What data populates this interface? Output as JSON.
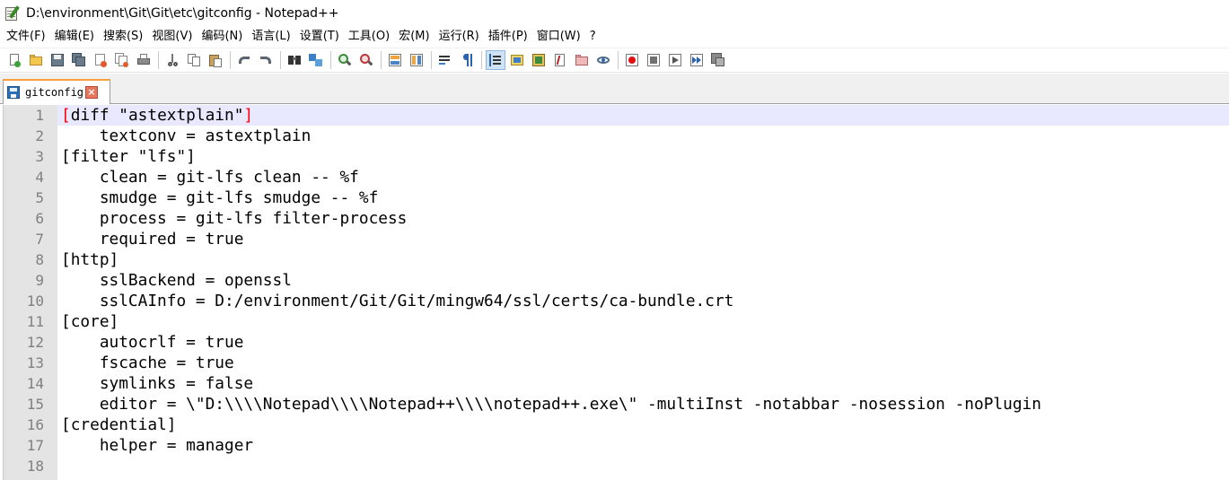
{
  "window": {
    "title": "D:\\environment\\Git\\Git\\etc\\gitconfig - Notepad++"
  },
  "menu": [
    "文件(F)",
    "编辑(E)",
    "搜索(S)",
    "视图(V)",
    "编码(N)",
    "语言(L)",
    "设置(T)",
    "工具(O)",
    "宏(M)",
    "运行(R)",
    "插件(P)",
    "窗口(W)",
    "?"
  ],
  "toolbar": {
    "icons": [
      "new-file-icon",
      "open-file-icon",
      "save-icon",
      "save-all-icon",
      "close-icon",
      "close-all-icon",
      "print-icon",
      "cut-icon",
      "copy-icon",
      "paste-icon",
      "undo-icon",
      "redo-icon",
      "find-icon",
      "replace-icon",
      "zoom-in-icon",
      "zoom-out-icon",
      "sync-vertical-scroll-icon",
      "sync-horizontal-scroll-icon",
      "word-wrap-icon",
      "show-all-characters-icon",
      "indent-guide-icon",
      "user-defined-language-icon",
      "document-map-icon",
      "function-list-icon",
      "folder-as-workspace-icon",
      "monitoring-icon",
      "record-macro-icon",
      "stop-recording-icon",
      "playback-macro-icon",
      "run-macro-multiple-icon",
      "save-macro-icon"
    ]
  },
  "tab": {
    "label": "gitconfig",
    "close_icon": "close-tab-icon",
    "status": "saved"
  },
  "editor": {
    "current_line": 1,
    "lines": [
      "[diff \"astextplain\"]",
      "    textconv = astextplain",
      "[filter \"lfs\"]",
      "    clean = git-lfs clean -- %f",
      "    smudge = git-lfs smudge -- %f",
      "    process = git-lfs filter-process",
      "    required = true",
      "[http]",
      "    sslBackend = openssl",
      "    sslCAInfo = D:/environment/Git/Git/mingw64/ssl/certs/ca-bundle.crt",
      "[core]",
      "    autocrlf = true",
      "    fscache = true",
      "    symlinks = false",
      "    editor = \\\"D:\\\\\\\\Notepad\\\\\\\\Notepad++\\\\\\\\notepad++.exe\\\" -multiInst -notabbar -nosession -noPlugin",
      "[credential]",
      "    helper = manager",
      ""
    ],
    "line_numbers": [
      "1",
      "2",
      "3",
      "4",
      "5",
      "6",
      "7",
      "8",
      "9",
      "10",
      "11",
      "12",
      "13",
      "14",
      "15",
      "16",
      "17",
      "18"
    ]
  },
  "colors": {
    "gutter_bg": "#e4e4e4",
    "current_line_bg": "#e8e8ff",
    "brace_highlight": "#ff0000",
    "tab_accent": "#f8a040"
  }
}
